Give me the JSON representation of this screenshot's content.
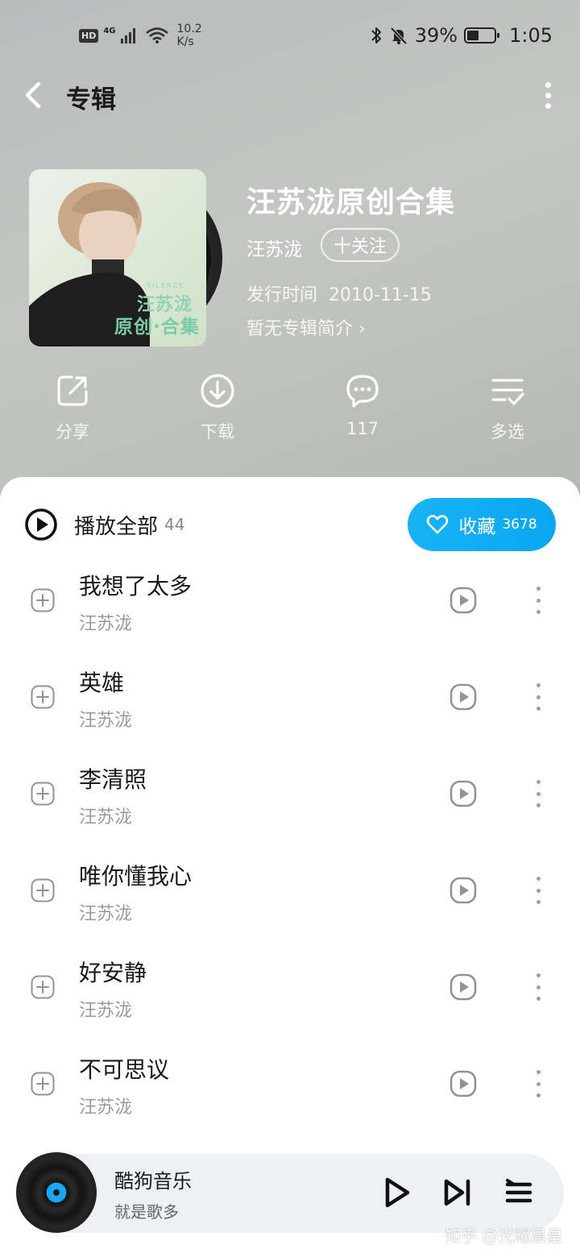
{
  "status_bar": {
    "hd": "HD",
    "network": "4G",
    "speed_value": "10.2",
    "speed_unit": "K/s",
    "battery_percent": "39%",
    "battery_level": 0.39,
    "time": "1:05"
  },
  "header": {
    "title": "专辑"
  },
  "album": {
    "cover_text_line1": "汪苏泷",
    "cover_text_line2": "原创·合集",
    "cover_small_text": "SILENCE",
    "title": "汪苏泷原创合集",
    "artist": "汪苏泷",
    "follow_label": "十关注",
    "release_label": "发行时间",
    "release_date": "2010-11-15",
    "intro_link": "暂无专辑简介 ›"
  },
  "actions": [
    {
      "label": "分享",
      "icon": "share-icon"
    },
    {
      "label": "下载",
      "icon": "download-icon"
    },
    {
      "label": "117",
      "icon": "comment-icon"
    },
    {
      "label": "多选",
      "icon": "multiselect-icon"
    }
  ],
  "list_header": {
    "play_all_label": "播放全部",
    "song_count": "44",
    "collect_label": "收藏",
    "collect_count": "3678"
  },
  "songs": [
    {
      "title": "我想了太多",
      "artist": "汪苏泷"
    },
    {
      "title": "英雄",
      "artist": "汪苏泷"
    },
    {
      "title": "李清照",
      "artist": "汪苏泷"
    },
    {
      "title": "唯你懂我心",
      "artist": "汪苏泷"
    },
    {
      "title": "好安静",
      "artist": "汪苏泷"
    },
    {
      "title": "不可思议",
      "artist": "汪苏泷"
    }
  ],
  "mini_player": {
    "title": "酷狗音乐",
    "subtitle": "就是歌多"
  },
  "watermark": "知乎 @光耀晨星",
  "colors": {
    "accent": "#0aa6f0",
    "header_bg": "#c0c3c0"
  }
}
